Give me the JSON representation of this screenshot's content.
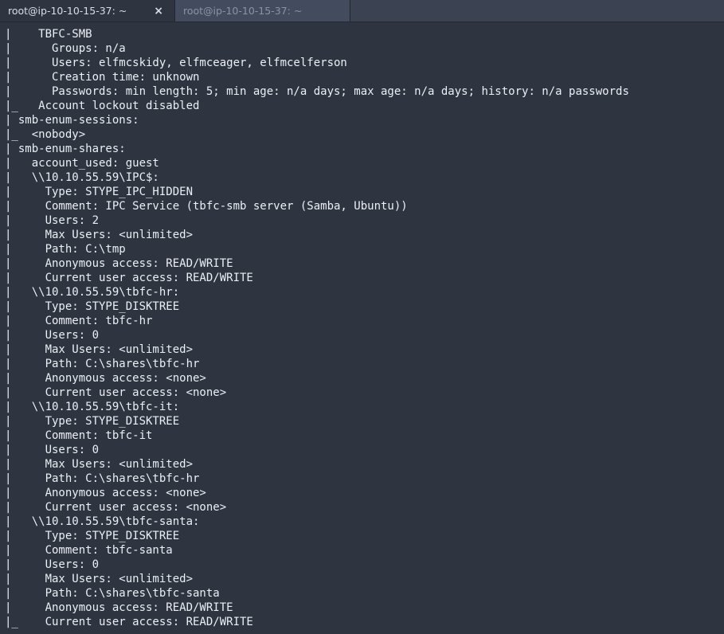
{
  "tabs": [
    {
      "title": "root@ip-10-10-15-37: ~",
      "active": true
    },
    {
      "title": "root@ip-10-10-15-37: ~",
      "active": false
    }
  ],
  "close_glyph": "×",
  "lines": [
    "|    TBFC-SMB",
    "|      Groups: n/a",
    "|      Users: elfmcskidy, elfmceager, elfmcelferson",
    "|      Creation time: unknown",
    "|      Passwords: min length: 5; min age: n/a days; max age: n/a days; history: n/a passwords",
    "|_   Account lockout disabled",
    "| smb-enum-sessions:",
    "|_  <nobody>",
    "| smb-enum-shares:",
    "|   account_used: guest",
    "|   \\\\10.10.55.59\\IPC$:",
    "|     Type: STYPE_IPC_HIDDEN",
    "|     Comment: IPC Service (tbfc-smb server (Samba, Ubuntu))",
    "|     Users: 2",
    "|     Max Users: <unlimited>",
    "|     Path: C:\\tmp",
    "|     Anonymous access: READ/WRITE",
    "|     Current user access: READ/WRITE",
    "|   \\\\10.10.55.59\\tbfc-hr:",
    "|     Type: STYPE_DISKTREE",
    "|     Comment: tbfc-hr",
    "|     Users: 0",
    "|     Max Users: <unlimited>",
    "|     Path: C:\\shares\\tbfc-hr",
    "|     Anonymous access: <none>",
    "|     Current user access: <none>",
    "|   \\\\10.10.55.59\\tbfc-it:",
    "|     Type: STYPE_DISKTREE",
    "|     Comment: tbfc-it",
    "|     Users: 0",
    "|     Max Users: <unlimited>",
    "|     Path: C:\\shares\\tbfc-hr",
    "|     Anonymous access: <none>",
    "|     Current user access: <none>",
    "|   \\\\10.10.55.59\\tbfc-santa:",
    "|     Type: STYPE_DISKTREE",
    "|     Comment: tbfc-santa",
    "|     Users: 0",
    "|     Max Users: <unlimited>",
    "|     Path: C:\\shares\\tbfc-santa",
    "|     Anonymous access: READ/WRITE",
    "|_    Current user access: READ/WRITE"
  ]
}
